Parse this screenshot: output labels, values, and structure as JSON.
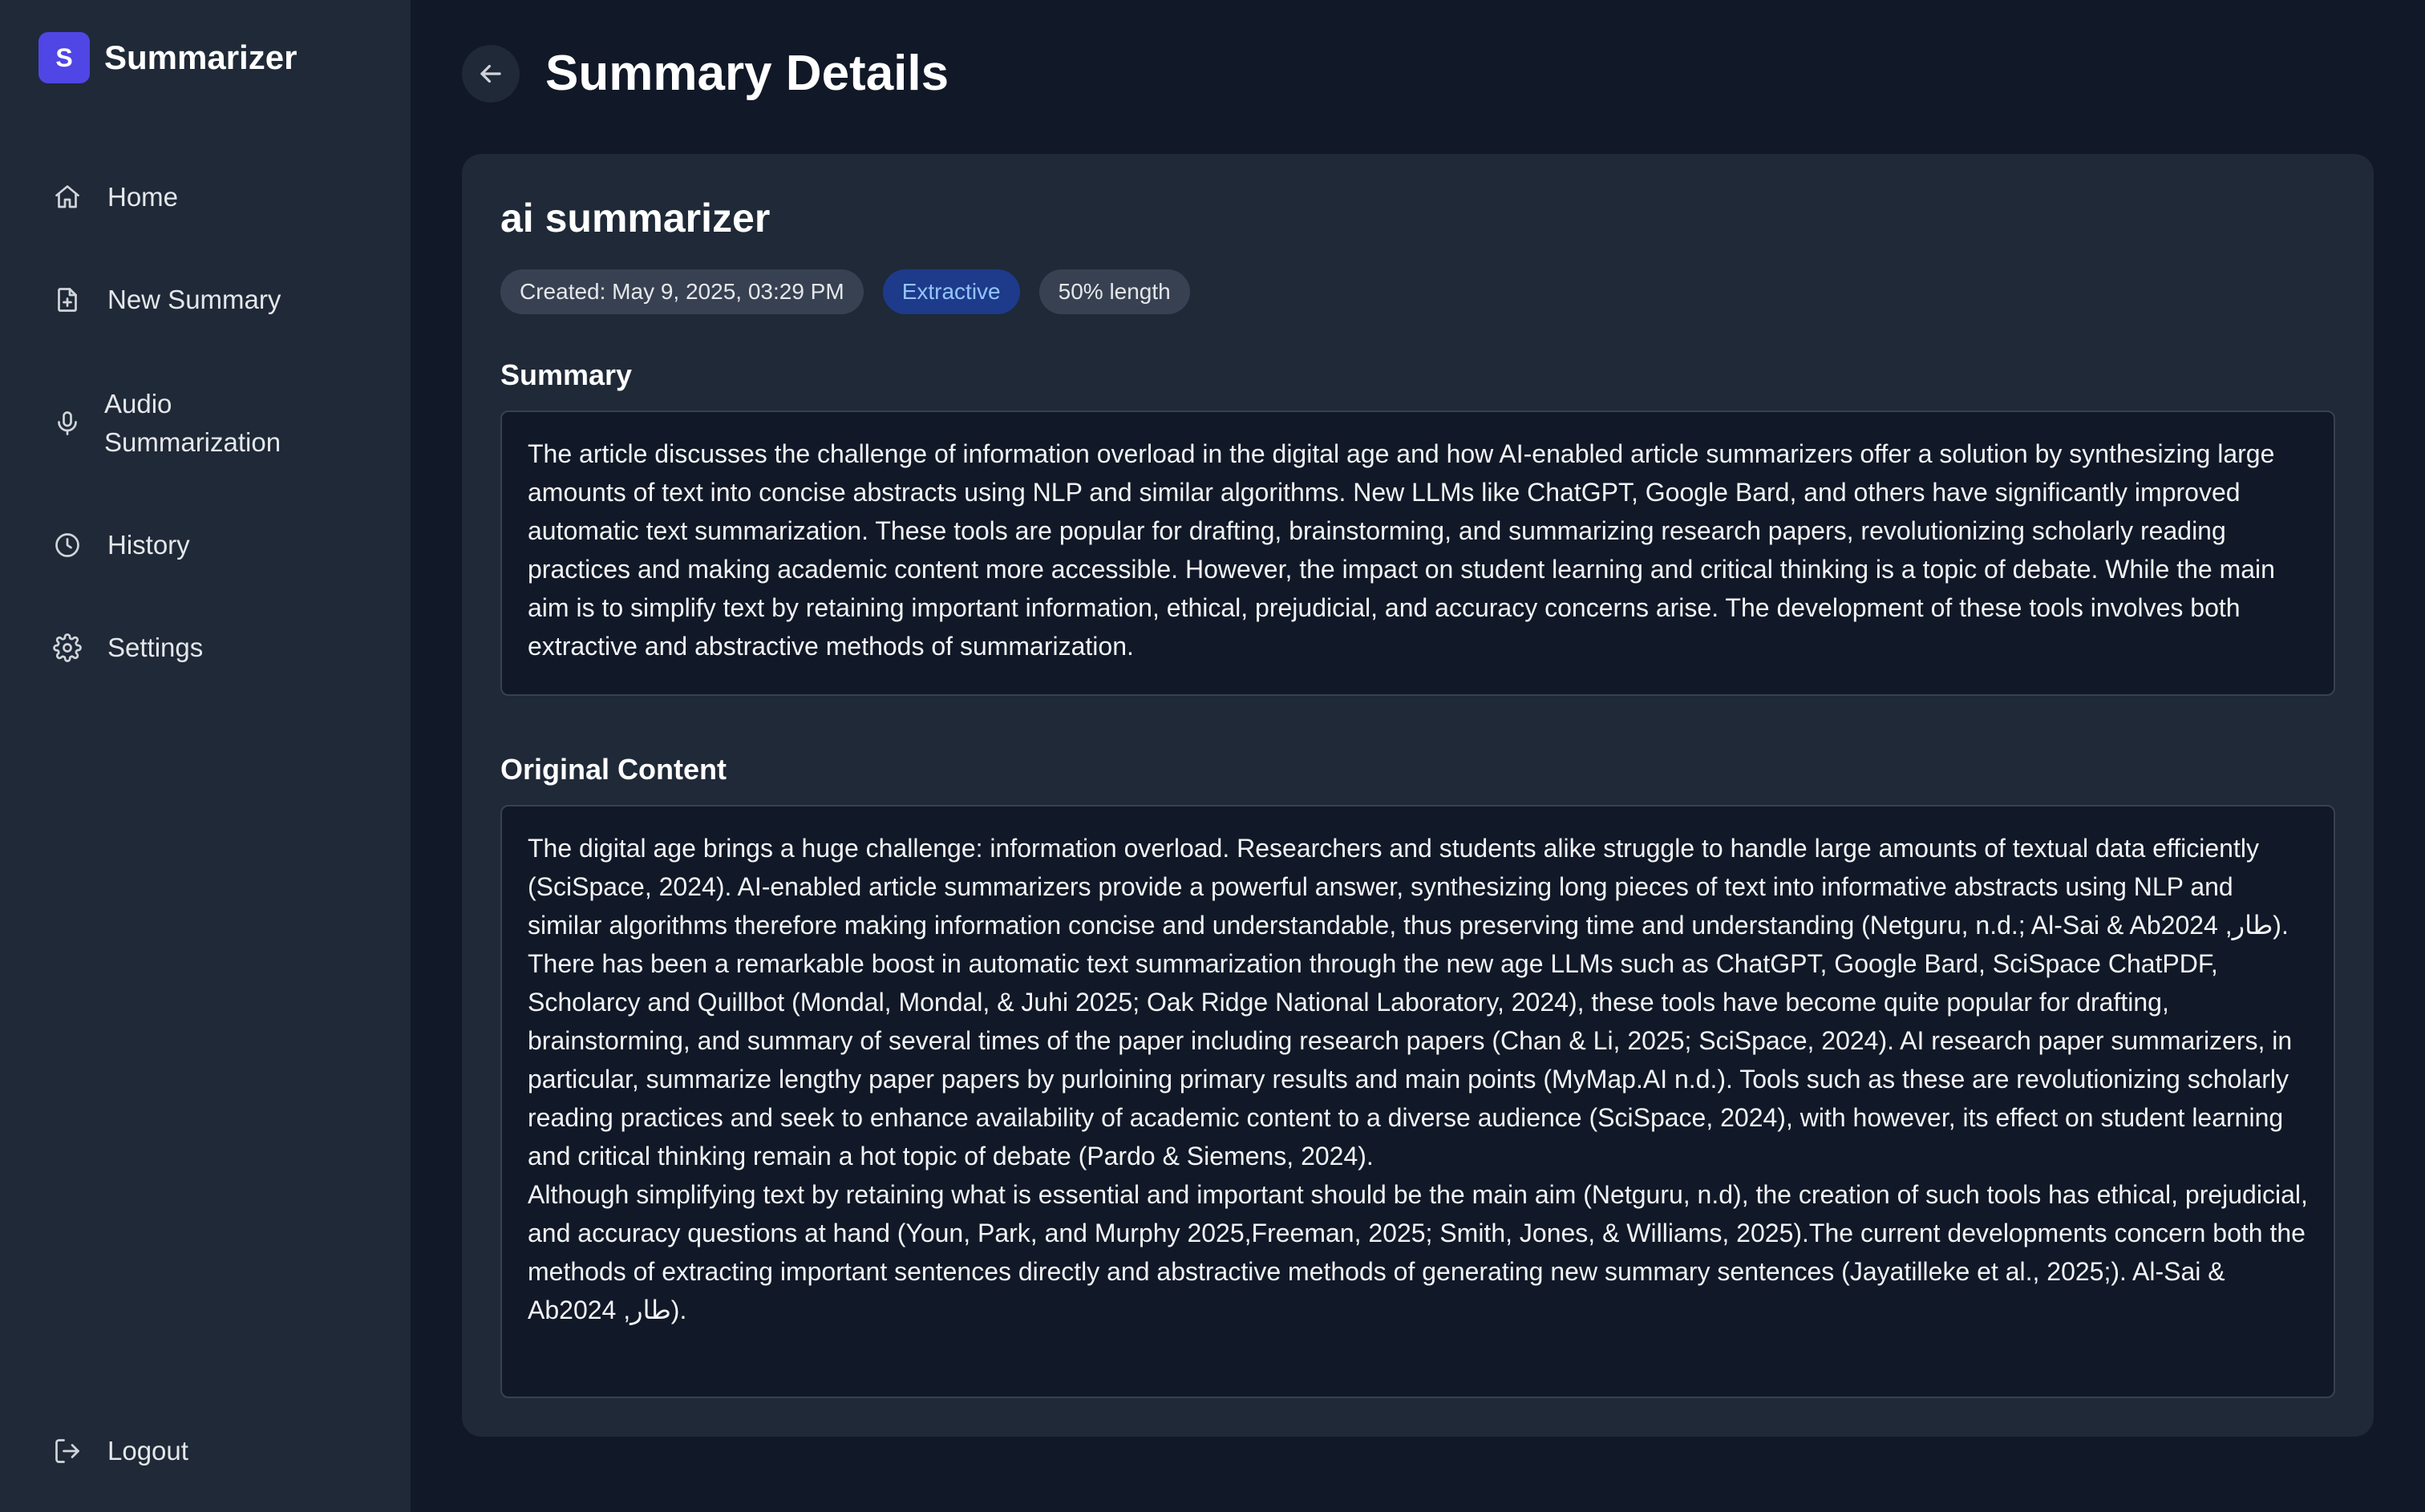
{
  "app": {
    "logo_letter": "S",
    "name": "Summarizer",
    "accent_color": "#4f46e5"
  },
  "sidebar": {
    "items": [
      {
        "label": "Home",
        "icon": "home-icon"
      },
      {
        "label": "New Summary",
        "icon": "file-plus-icon"
      },
      {
        "label": "Audio Summarization",
        "icon": "microphone-icon"
      },
      {
        "label": "History",
        "icon": "clock-icon"
      },
      {
        "label": "Settings",
        "icon": "gear-icon"
      }
    ],
    "logout_label": "Logout"
  },
  "header": {
    "title": "Summary Details",
    "back_icon": "arrow-left-icon"
  },
  "summary_card": {
    "title": "ai summarizer",
    "badges": {
      "created": "Created: May 9, 2025, 03:29 PM",
      "method": "Extractive",
      "length": "50% length"
    },
    "summary_heading": "Summary",
    "summary_text": "The article discusses the challenge of information overload in the digital age and how AI-enabled article summarizers offer a solution by synthesizing large amounts of text into concise abstracts using NLP and similar algorithms. New LLMs like ChatGPT, Google Bard, and others have significantly improved automatic text summarization. These tools are popular for drafting, brainstorming, and summarizing research papers, revolutionizing scholarly reading practices and making academic content more accessible. However, the impact on student learning and critical thinking is a topic of debate. While the main aim is to simplify text by retaining important information, ethical, prejudicial, and accuracy concerns arise. The development of these tools involves both extractive and abstractive methods of summarization.",
    "original_heading": "Original Content",
    "original_paragraphs": [
      "The digital age brings a huge challenge: information overload. Researchers and students alike struggle to handle large amounts of textual data efficiently (SciSpace, 2024). AI-enabled article summarizers provide a powerful answer, synthesizing long pieces of text into informative abstracts using NLP and similar algorithms therefore making information concise and understandable, thus preserving time and understanding (Netguru, n.d.; Al-Sai & Ab2024 ,طار).",
      "There has been a remarkable boost in automatic text summarization through the new age LLMs such as ChatGPT, Google Bard, SciSpace ChatPDF, Scholarcy and Quillbot (Mondal, Mondal, & Juhi 2025; Oak Ridge National Laboratory, 2024), these tools have become quite popular for drafting, brainstorming, and summary of several times of the paper including research papers (Chan & Li, 2025; SciSpace, 2024). AI research paper summarizers, in particular, summarize lengthy paper papers by purloining primary results and main points (MyMap.AI n.d.). Tools such as these are revolutionizing scholarly reading practices and seek to enhance availability of academic content to a diverse audience (SciSpace, 2024), with however, its effect on student learning and critical thinking remain a hot topic of debate (Pardo & Siemens, 2024).",
      "Although simplifying text by retaining what is essential and important should be the main aim (Netguru, n.d), the creation of such tools has ethical, prejudicial, and accuracy questions at hand (Youn, Park, and Murphy 2025,Freeman, 2025; Smith, Jones, & Williams, 2025).The current developments concern both the methods of extracting important sentences directly and abstractive methods of generating new summary sentences (Jayatilleke et al., 2025;). Al-Sai & Ab2024 ,طار)."
    ]
  }
}
